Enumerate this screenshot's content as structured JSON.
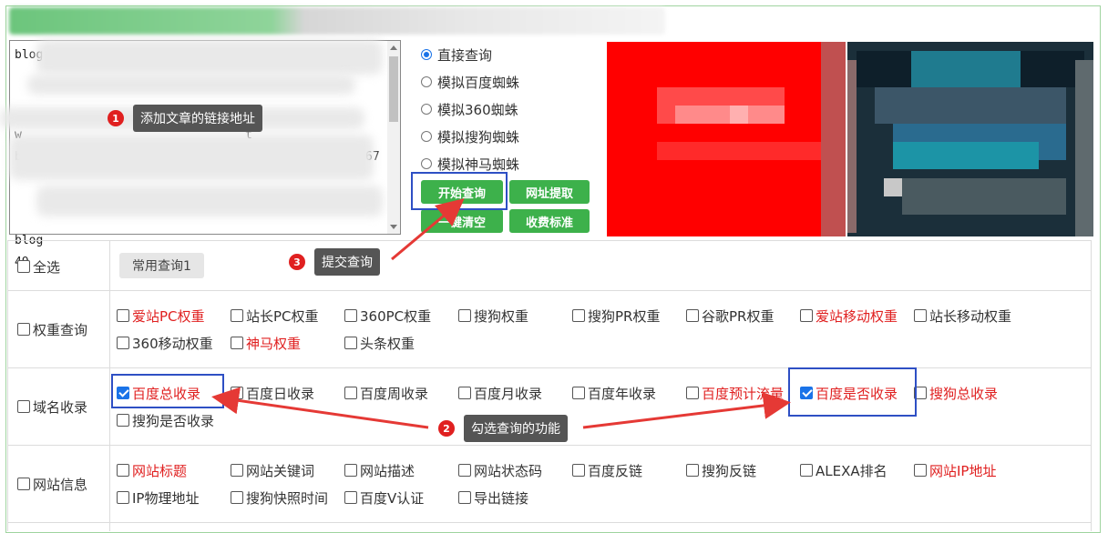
{
  "url_box": {
    "lines": [
      "blog",
      "w",
      "t",
      "blo",
      "67",
      "blog",
      "49"
    ]
  },
  "query_modes": {
    "options": [
      {
        "label": "直接查询",
        "selected": true
      },
      {
        "label": "模拟百度蜘蛛",
        "selected": false
      },
      {
        "label": "模拟360蜘蛛",
        "selected": false
      },
      {
        "label": "模拟搜狗蜘蛛",
        "selected": false
      },
      {
        "label": "模拟神马蜘蛛",
        "selected": false
      }
    ]
  },
  "buttons": {
    "start_query": "开始查询",
    "extract_urls": "网址提取",
    "clear_all": "一键清空",
    "pricing": "收费标准"
  },
  "select_all_row": {
    "label": "全选",
    "common_query": "常用查询1"
  },
  "weight_row": {
    "label": "权重查询",
    "options": [
      {
        "label": "爱站PC权重",
        "red": true,
        "checked": false
      },
      {
        "label": "站长PC权重",
        "red": false,
        "checked": false
      },
      {
        "label": "360PC权重",
        "red": false,
        "checked": false
      },
      {
        "label": "搜狗权重",
        "red": false,
        "checked": false
      },
      {
        "label": "搜狗PR权重",
        "red": false,
        "checked": false
      },
      {
        "label": "谷歌PR权重",
        "red": false,
        "checked": false
      },
      {
        "label": "爱站移动权重",
        "red": true,
        "checked": false
      },
      {
        "label": "站长移动权重",
        "red": false,
        "checked": false
      },
      {
        "label": "360移动权重",
        "red": false,
        "checked": false
      },
      {
        "label": "神马权重",
        "red": true,
        "checked": false
      },
      {
        "label": "头条权重",
        "red": false,
        "checked": false
      }
    ]
  },
  "index_row": {
    "label": "域名收录",
    "options": [
      {
        "label": "百度总收录",
        "red": true,
        "checked": true
      },
      {
        "label": "百度日收录",
        "red": false,
        "checked": false
      },
      {
        "label": "百度周收录",
        "red": false,
        "checked": false
      },
      {
        "label": "百度月收录",
        "red": false,
        "checked": false
      },
      {
        "label": "百度年收录",
        "red": false,
        "checked": false
      },
      {
        "label": "百度预计流量",
        "red": true,
        "checked": false
      },
      {
        "label": "百度是否收录",
        "red": true,
        "checked": true
      },
      {
        "label": "搜狗总收录",
        "red": true,
        "checked": false
      },
      {
        "label": "搜狗是否收录",
        "red": false,
        "checked": false
      }
    ]
  },
  "site_row": {
    "label": "网站信息",
    "options": [
      {
        "label": "网站标题",
        "red": true,
        "checked": false
      },
      {
        "label": "网站关键词",
        "red": false,
        "checked": false
      },
      {
        "label": "网站描述",
        "red": false,
        "checked": false
      },
      {
        "label": "网站状态码",
        "red": false,
        "checked": false
      },
      {
        "label": "百度反链",
        "red": false,
        "checked": false
      },
      {
        "label": "搜狗反链",
        "red": false,
        "checked": false
      },
      {
        "label": "ALEXA排名",
        "red": false,
        "checked": false
      },
      {
        "label": "网站IP地址",
        "red": true,
        "checked": false
      },
      {
        "label": "IP物理地址",
        "red": false,
        "checked": false
      },
      {
        "label": "搜狗快照时间",
        "red": false,
        "checked": false
      },
      {
        "label": "百度V认证",
        "red": false,
        "checked": false
      },
      {
        "label": "导出链接",
        "red": false,
        "checked": false
      }
    ]
  },
  "annotations": {
    "step1": {
      "num": "1",
      "text": "添加文章的链接地址"
    },
    "step2": {
      "num": "2",
      "text": "勾选查询的功能"
    },
    "step3": {
      "num": "3",
      "text": "提交查询"
    }
  },
  "colors": {
    "accent_green": "#3db14b",
    "highlight_red": "#e02020",
    "annotation_box": "#2e4fc4"
  }
}
